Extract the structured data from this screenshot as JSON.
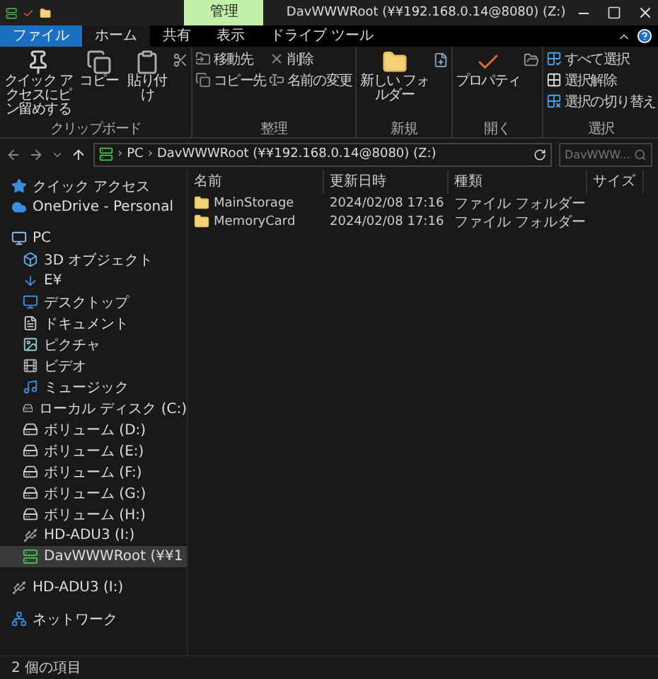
{
  "window": {
    "context_tab": "管理",
    "title": "DavWWWRoot (¥¥192.168.0.14@8080) (Z:)"
  },
  "ribbon_tabs": [
    {
      "label": "ファイル",
      "kind": "file",
      "selected": false
    },
    {
      "label": "ホーム",
      "kind": "tab",
      "selected": true
    },
    {
      "label": "共有",
      "kind": "tab",
      "selected": false
    },
    {
      "label": "表示",
      "kind": "tab",
      "selected": false
    },
    {
      "label": "ドライブ ツール",
      "kind": "tab",
      "selected": false
    }
  ],
  "ribbon_groups": [
    {
      "label": "クリップボード",
      "commands": [
        {
          "label": "クイック アクセスにピン留めする",
          "kind": "large"
        },
        {
          "label": "コピー",
          "kind": "large"
        },
        {
          "label": "貼り付け",
          "kind": "large"
        },
        {
          "kind": "tools"
        }
      ]
    },
    {
      "label": "整理",
      "commands": [
        {
          "label": "移動先",
          "kind": "small"
        },
        {
          "label": "コピー先",
          "kind": "small"
        },
        {
          "label": "削除",
          "kind": "small"
        },
        {
          "label": "名前の変更",
          "kind": "small"
        }
      ]
    },
    {
      "label": "新規",
      "commands": [
        {
          "label": "新しい フォルダー",
          "kind": "large"
        },
        {
          "kind": "tools"
        }
      ]
    },
    {
      "label": "開く",
      "commands": [
        {
          "label": "プロパティ",
          "kind": "large"
        },
        {
          "kind": "tools"
        }
      ]
    },
    {
      "label": "選択",
      "commands": [
        {
          "label": "すべて選択",
          "kind": "small"
        },
        {
          "label": "選択解除",
          "kind": "small"
        },
        {
          "label": "選択の切り替え",
          "kind": "small"
        }
      ]
    }
  ],
  "address": {
    "separator": "›",
    "segments": [
      "PC",
      "DavWWWRoot (¥¥192.168.0.14@8080) (Z:)"
    ],
    "search_placeholder": "DavWWW..."
  },
  "sidebar": [
    {
      "label": "クイック アクセス",
      "selected": false
    },
    {
      "label": "OneDrive - Personal",
      "selected": false
    },
    {
      "label": "PC",
      "selected": false,
      "children": [
        {
          "label": "3D オブジェクト",
          "selected": false
        },
        {
          "label": "E¥",
          "selected": false
        },
        {
          "label": "デスクトップ",
          "selected": false
        },
        {
          "label": "ドキュメント",
          "selected": false
        },
        {
          "label": "ピクチャ",
          "selected": false
        },
        {
          "label": "ビデオ",
          "selected": false
        },
        {
          "label": "ミュージック",
          "selected": false
        },
        {
          "label": "ローカル ディスク (C:)",
          "selected": false
        },
        {
          "label": "ボリューム (D:)",
          "selected": false
        },
        {
          "label": "ボリューム (E:)",
          "selected": false
        },
        {
          "label": "ボリューム (F:)",
          "selected": false
        },
        {
          "label": "ボリューム (G:)",
          "selected": false
        },
        {
          "label": "ボリューム (H:)",
          "selected": false
        },
        {
          "label": "HD-ADU3 (I:)",
          "selected": false
        },
        {
          "label": "DavWWWRoot (¥¥1",
          "selected": true
        }
      ]
    },
    {
      "label": "HD-ADU3 (I:)",
      "selected": false
    },
    {
      "label": "ネットワーク",
      "selected": false
    }
  ],
  "columns": [
    "名前",
    "更新日時",
    "種類",
    "サイズ"
  ],
  "rows": [
    {
      "name": "MainStorage",
      "modified": "2024/02/08 17:16",
      "type": "ファイル フォルダー"
    },
    {
      "name": "MemoryCard",
      "modified": "2024/02/08 17:16",
      "type": "ファイル フォルダー"
    }
  ],
  "status_bar": {
    "count": "2 個の項目"
  }
}
